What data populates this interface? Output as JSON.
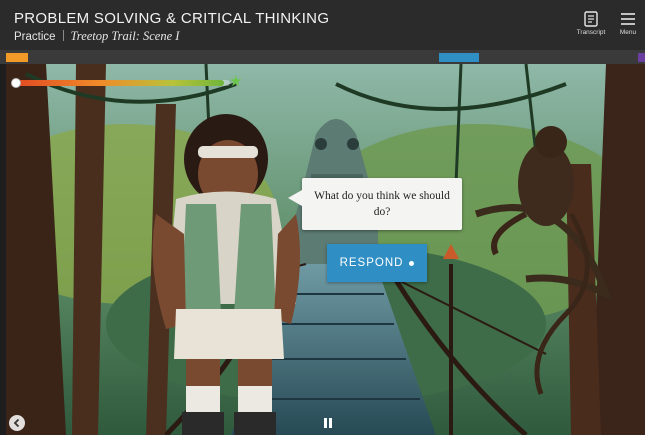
{
  "header": {
    "course_title": "PROBLEM SOLVING & CRITICAL THINKING",
    "section": "Practice",
    "scene": "Treetop Trail: Scene I",
    "transcript_label": "Transcript",
    "menu_label": "Menu"
  },
  "icons": {
    "transcript": "transcript-icon",
    "menu": "hamburger-menu-icon",
    "back": "chevron-left-icon",
    "pause": "pause-icon",
    "meter_goal": "star-icon"
  },
  "colors": {
    "accent_blue": "#2f8fc4",
    "progress_orange": "#f29a28",
    "progress_purple": "#6b3fa0",
    "meter_green": "#6cc64a"
  },
  "dialog": {
    "question": "What do you think we should do?",
    "respond_label": "RESPOND"
  },
  "meter": {
    "level": 0.97
  }
}
